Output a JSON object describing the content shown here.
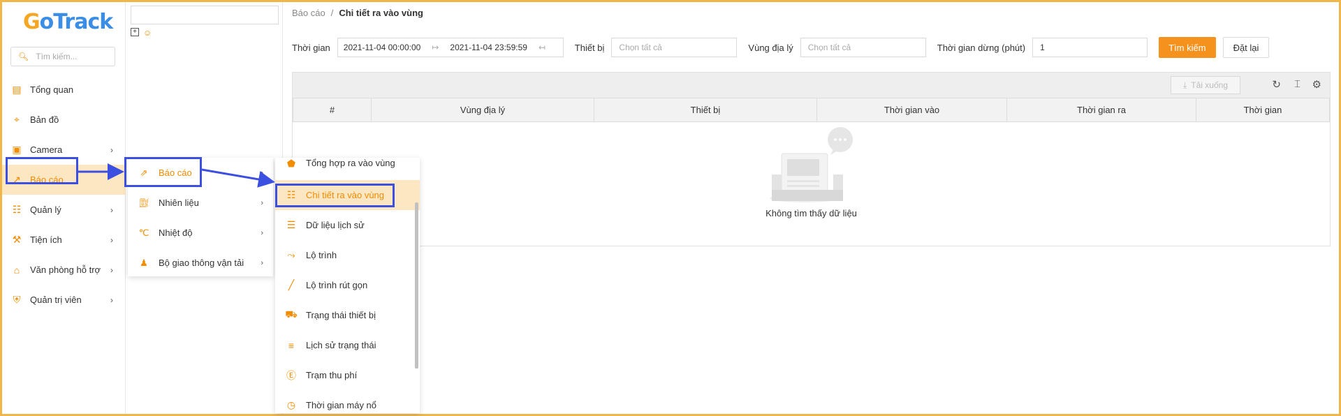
{
  "brand": {
    "logo_text_g": "G",
    "logo_text_rest": "oTrack"
  },
  "sidebar": {
    "search_placeholder": "Tìm kiếm...",
    "items": [
      {
        "label": "Tổng quan",
        "icon": "dashboard-icon",
        "has_children": false
      },
      {
        "label": "Bản đồ",
        "icon": "map-icon",
        "has_children": false
      },
      {
        "label": "Camera",
        "icon": "camera-icon",
        "has_children": true
      },
      {
        "label": "Báo cáo",
        "icon": "report-icon",
        "has_children": false,
        "active": true
      },
      {
        "label": "Quản lý",
        "icon": "grid-icon",
        "has_children": true
      },
      {
        "label": "Tiện ích",
        "icon": "tools-icon",
        "has_children": true
      },
      {
        "label": "Văn phòng hỗ trợ",
        "icon": "store-icon",
        "has_children": true
      },
      {
        "label": "Quản trị viên",
        "icon": "shield-icon",
        "has_children": true
      }
    ]
  },
  "submenu": {
    "items": [
      {
        "label": "Báo cáo",
        "icon": "chart-line-icon",
        "active": true
      },
      {
        "label": "Nhiên liệu",
        "icon": "fuel-icon"
      },
      {
        "label": "Nhiệt độ",
        "icon": "thermometer-icon"
      },
      {
        "label": "Bộ giao thông vận tải",
        "icon": "officer-icon"
      }
    ]
  },
  "report_menu": {
    "items": [
      {
        "label": "Tổng hợp ra vào vùng",
        "icon": "pentagon-icon"
      },
      {
        "label": "Chi tiết ra vào vùng",
        "icon": "document-icon",
        "active": true
      },
      {
        "label": "Dữ liệu lịch sử",
        "icon": "ledger-icon"
      },
      {
        "label": "Lộ trình",
        "icon": "route-icon"
      },
      {
        "label": "Lộ trình rút gọn",
        "icon": "polyline-icon"
      },
      {
        "label": "Trạng thái thiết bị",
        "icon": "car-icon"
      },
      {
        "label": "Lịch sử trạng thái",
        "icon": "history-list-icon"
      },
      {
        "label": "Trạm thu phí",
        "icon": "toll-icon"
      },
      {
        "label": "Thời gian máy nổ",
        "icon": "clock-icon"
      }
    ]
  },
  "breadcrumb": {
    "parent": "Báo cáo",
    "separator": "/",
    "current": "Chi tiết ra vào vùng"
  },
  "filters": {
    "time_label": "Thời gian",
    "start": "2021-11-04 00:00:00",
    "end": "2021-11-04 23:59:59",
    "device_label": "Thiết bị",
    "device_placeholder": "Chọn tất cả",
    "zone_label": "Vùng địa lý",
    "zone_placeholder": "Chọn tất cả",
    "stop_label": "Thời gian dừng (phút)",
    "stop_value": "1",
    "search_button": "Tìm kiếm",
    "reset_button": "Đặt lại"
  },
  "table": {
    "download_label": "Tải xuống",
    "columns": [
      "#",
      "Vùng địa lý",
      "Thiết bị",
      "Thời gian vào",
      "Thời gian ra",
      "Thời gian"
    ],
    "empty_text": "Không tìm thấy dữ liệu"
  },
  "colors": {
    "accent": "#f5921e",
    "highlight": "#3b4fe0",
    "active_bg": "#fde6c2"
  }
}
